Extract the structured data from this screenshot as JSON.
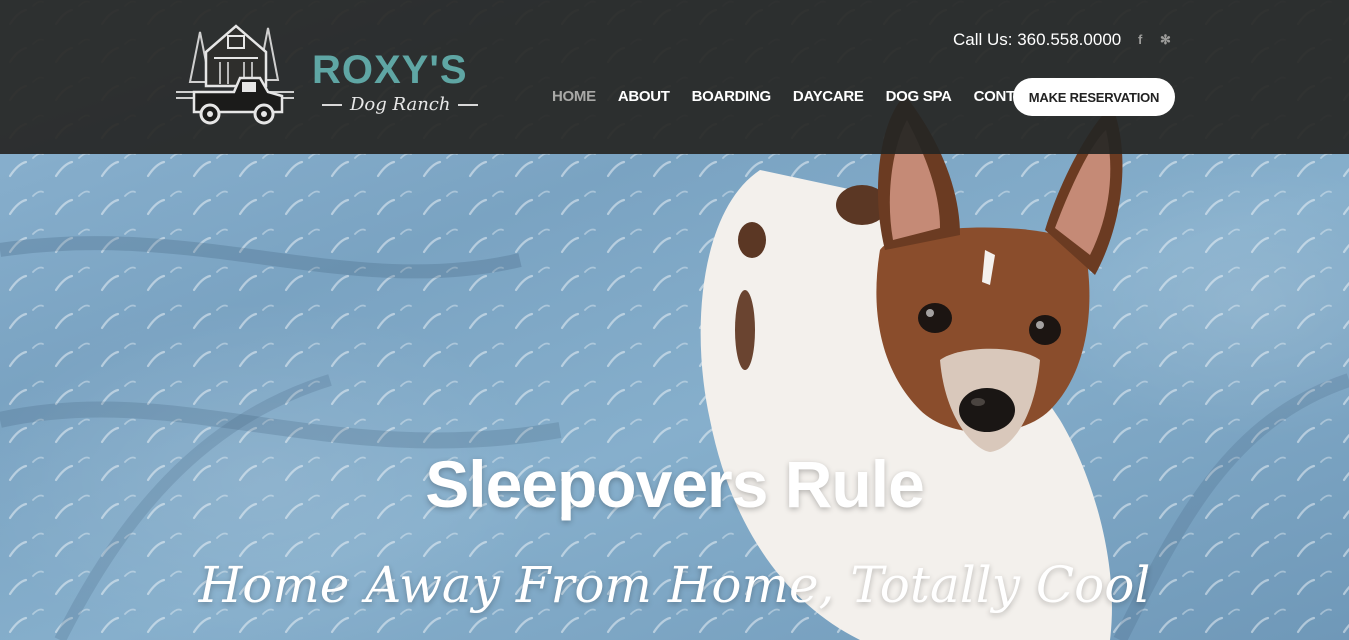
{
  "brand": {
    "title": "ROXY'S",
    "subtitle": "Dog Ranch",
    "accent": "#5fa6a4"
  },
  "header": {
    "phone": "Call Us: 360.558.0000",
    "social": [
      {
        "icon": "facebook-icon",
        "glyph": "f"
      },
      {
        "icon": "yelp-icon",
        "glyph": "✻"
      }
    ],
    "nav": [
      {
        "label": "HOME",
        "active": true
      },
      {
        "label": "ABOUT",
        "active": false
      },
      {
        "label": "BOARDING",
        "active": false
      },
      {
        "label": "DAYCARE",
        "active": false
      },
      {
        "label": "DOG SPA",
        "active": false
      },
      {
        "label": "CONTACT",
        "active": false
      }
    ],
    "cta_label": "MAKE RESERVATION",
    "background": "#262624"
  },
  "hero": {
    "title": "Sleepovers Rule",
    "subtitle": "Home Away From Home, Totally Cool"
  }
}
